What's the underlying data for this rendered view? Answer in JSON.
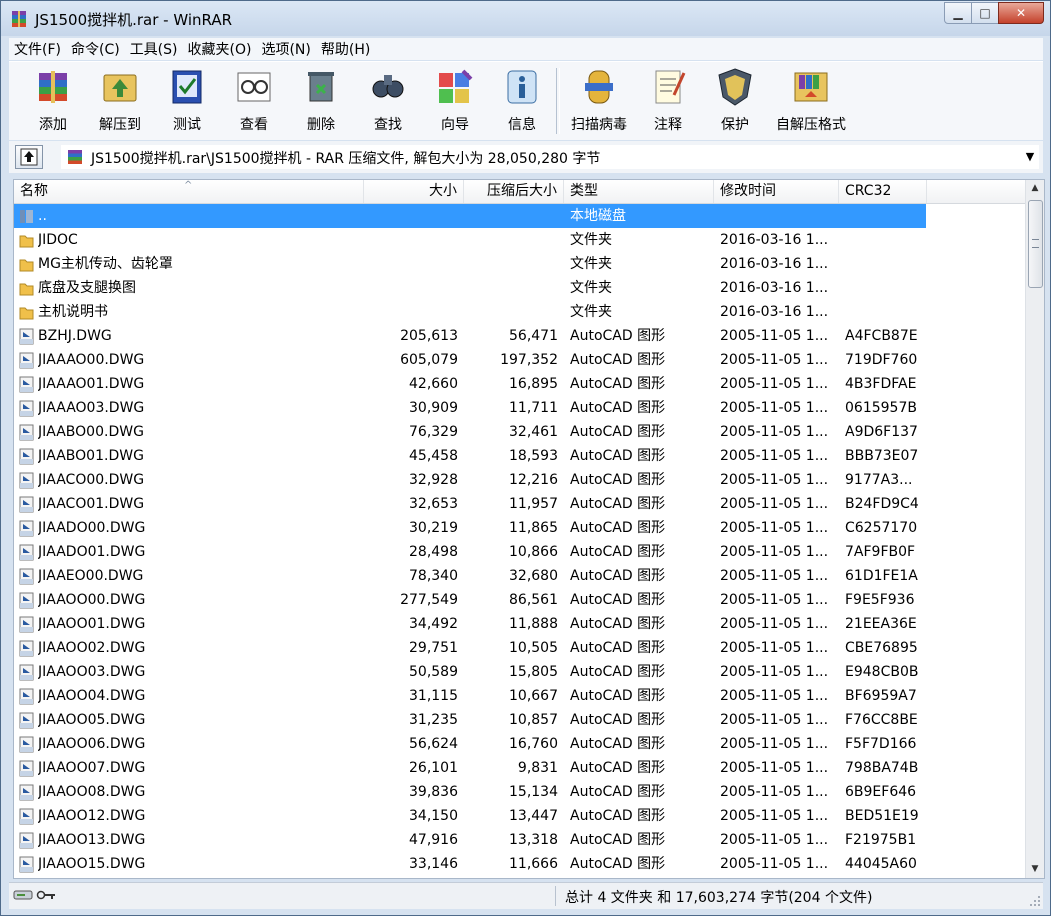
{
  "window": {
    "title": "JS1500搅拌机.rar - WinRAR"
  },
  "menu": [
    {
      "label": "文件(F)",
      "name": "menu-file"
    },
    {
      "label": "命令(C)",
      "name": "menu-commands"
    },
    {
      "label": "工具(S)",
      "name": "menu-tools"
    },
    {
      "label": "收藏夹(O)",
      "name": "menu-favorites"
    },
    {
      "label": "选项(N)",
      "name": "menu-options"
    },
    {
      "label": "帮助(H)",
      "name": "menu-help"
    }
  ],
  "toolbar": [
    {
      "label": "添加",
      "icon": "add-archive-icon"
    },
    {
      "label": "解压到",
      "icon": "extract-to-icon"
    },
    {
      "label": "测试",
      "icon": "test-icon"
    },
    {
      "label": "查看",
      "icon": "view-icon"
    },
    {
      "label": "删除",
      "icon": "delete-icon"
    },
    {
      "label": "查找",
      "icon": "find-icon"
    },
    {
      "label": "向导",
      "icon": "wizard-icon"
    },
    {
      "label": "信息",
      "icon": "info-icon"
    },
    {
      "label": "扫描病毒",
      "icon": "virus-scan-icon"
    },
    {
      "label": "注释",
      "icon": "comment-icon"
    },
    {
      "label": "保护",
      "icon": "protect-icon"
    },
    {
      "label": "自解压格式",
      "icon": "sfx-icon"
    }
  ],
  "address": {
    "path": "JS1500搅拌机.rar\\JS1500搅拌机 - RAR 压缩文件, 解包大小为 28,050,280 字节"
  },
  "columns": {
    "name": "名称",
    "size": "大小",
    "packed": "压缩后大小",
    "type": "类型",
    "modified": "修改时间",
    "crc": "CRC32"
  },
  "files": [
    {
      "icon": "parent-folder-icon",
      "name": "..",
      "size": "",
      "packed": "",
      "type": "本地磁盘",
      "modified": "",
      "crc": "",
      "selected": true
    },
    {
      "icon": "folder-icon",
      "name": "JIDOC",
      "size": "",
      "packed": "",
      "type": "文件夹",
      "modified": "2016-03-16 1...",
      "crc": ""
    },
    {
      "icon": "folder-icon",
      "name": "MG主机传动、齿轮罩",
      "size": "",
      "packed": "",
      "type": "文件夹",
      "modified": "2016-03-16 1...",
      "crc": ""
    },
    {
      "icon": "folder-icon",
      "name": "底盘及支腿换图",
      "size": "",
      "packed": "",
      "type": "文件夹",
      "modified": "2016-03-16 1...",
      "crc": ""
    },
    {
      "icon": "folder-icon",
      "name": "主机说明书",
      "size": "",
      "packed": "",
      "type": "文件夹",
      "modified": "2016-03-16 1...",
      "crc": ""
    },
    {
      "icon": "dwg-file-icon",
      "name": "BZHJ.DWG",
      "size": "205,613",
      "packed": "56,471",
      "type": "AutoCAD 图形",
      "modified": "2005-11-05 1...",
      "crc": "A4FCB87E"
    },
    {
      "icon": "dwg-file-icon",
      "name": "JIAAAO00.DWG",
      "size": "605,079",
      "packed": "197,352",
      "type": "AutoCAD 图形",
      "modified": "2005-11-05 1...",
      "crc": "719DF760"
    },
    {
      "icon": "dwg-file-icon",
      "name": "JIAAAO01.DWG",
      "size": "42,660",
      "packed": "16,895",
      "type": "AutoCAD 图形",
      "modified": "2005-11-05 1...",
      "crc": "4B3FDFAE"
    },
    {
      "icon": "dwg-file-icon",
      "name": "JIAAAO03.DWG",
      "size": "30,909",
      "packed": "11,711",
      "type": "AutoCAD 图形",
      "modified": "2005-11-05 1...",
      "crc": "0615957B"
    },
    {
      "icon": "dwg-file-icon",
      "name": "JIAABO00.DWG",
      "size": "76,329",
      "packed": "32,461",
      "type": "AutoCAD 图形",
      "modified": "2005-11-05 1...",
      "crc": "A9D6F137"
    },
    {
      "icon": "dwg-file-icon",
      "name": "JIAABO01.DWG",
      "size": "45,458",
      "packed": "18,593",
      "type": "AutoCAD 图形",
      "modified": "2005-11-05 1...",
      "crc": "BBB73E07"
    },
    {
      "icon": "dwg-file-icon",
      "name": "JIAACO00.DWG",
      "size": "32,928",
      "packed": "12,216",
      "type": "AutoCAD 图形",
      "modified": "2005-11-05 1...",
      "crc": "9177A3..."
    },
    {
      "icon": "dwg-file-icon",
      "name": "JIAACO01.DWG",
      "size": "32,653",
      "packed": "11,957",
      "type": "AutoCAD 图形",
      "modified": "2005-11-05 1...",
      "crc": "B24FD9C4"
    },
    {
      "icon": "dwg-file-icon",
      "name": "JIAADO00.DWG",
      "size": "30,219",
      "packed": "11,865",
      "type": "AutoCAD 图形",
      "modified": "2005-11-05 1...",
      "crc": "C6257170"
    },
    {
      "icon": "dwg-file-icon",
      "name": "JIAADO01.DWG",
      "size": "28,498",
      "packed": "10,866",
      "type": "AutoCAD 图形",
      "modified": "2005-11-05 1...",
      "crc": "7AF9FB0F"
    },
    {
      "icon": "dwg-file-icon",
      "name": "JIAAEO00.DWG",
      "size": "78,340",
      "packed": "32,680",
      "type": "AutoCAD 图形",
      "modified": "2005-11-05 1...",
      "crc": "61D1FE1A"
    },
    {
      "icon": "dwg-file-icon",
      "name": "JIAAOO00.DWG",
      "size": "277,549",
      "packed": "86,561",
      "type": "AutoCAD 图形",
      "modified": "2005-11-05 1...",
      "crc": "F9E5F936"
    },
    {
      "icon": "dwg-file-icon",
      "name": "JIAAOO01.DWG",
      "size": "34,492",
      "packed": "11,888",
      "type": "AutoCAD 图形",
      "modified": "2005-11-05 1...",
      "crc": "21EEA36E"
    },
    {
      "icon": "dwg-file-icon",
      "name": "JIAAOO02.DWG",
      "size": "29,751",
      "packed": "10,505",
      "type": "AutoCAD 图形",
      "modified": "2005-11-05 1...",
      "crc": "CBE76895"
    },
    {
      "icon": "dwg-file-icon",
      "name": "JIAAOO03.DWG",
      "size": "50,589",
      "packed": "15,805",
      "type": "AutoCAD 图形",
      "modified": "2005-11-05 1...",
      "crc": "E948CB0B"
    },
    {
      "icon": "dwg-file-icon",
      "name": "JIAAOO04.DWG",
      "size": "31,115",
      "packed": "10,667",
      "type": "AutoCAD 图形",
      "modified": "2005-11-05 1...",
      "crc": "BF6959A7"
    },
    {
      "icon": "dwg-file-icon",
      "name": "JIAAOO05.DWG",
      "size": "31,235",
      "packed": "10,857",
      "type": "AutoCAD 图形",
      "modified": "2005-11-05 1...",
      "crc": "F76CC8BE"
    },
    {
      "icon": "dwg-file-icon",
      "name": "JIAAOO06.DWG",
      "size": "56,624",
      "packed": "16,760",
      "type": "AutoCAD 图形",
      "modified": "2005-11-05 1...",
      "crc": "F5F7D166"
    },
    {
      "icon": "dwg-file-icon",
      "name": "JIAAOO07.DWG",
      "size": "26,101",
      "packed": "9,831",
      "type": "AutoCAD 图形",
      "modified": "2005-11-05 1...",
      "crc": "798BA74B"
    },
    {
      "icon": "dwg-file-icon",
      "name": "JIAAOO08.DWG",
      "size": "39,836",
      "packed": "15,134",
      "type": "AutoCAD 图形",
      "modified": "2005-11-05 1...",
      "crc": "6B9EF646"
    },
    {
      "icon": "dwg-file-icon",
      "name": "JIAAOO12.DWG",
      "size": "34,150",
      "packed": "13,447",
      "type": "AutoCAD 图形",
      "modified": "2005-11-05 1...",
      "crc": "BED51E19"
    },
    {
      "icon": "dwg-file-icon",
      "name": "JIAAOO13.DWG",
      "size": "47,916",
      "packed": "13,318",
      "type": "AutoCAD 图形",
      "modified": "2005-11-05 1...",
      "crc": "F21975B1"
    },
    {
      "icon": "dwg-file-icon",
      "name": "JIAAOO15.DWG",
      "size": "33,146",
      "packed": "11,666",
      "type": "AutoCAD 图形",
      "modified": "2005-11-05 1...",
      "crc": "44045A60"
    }
  ],
  "status": {
    "text": "总计 4 文件夹 和 17,603,274 字节(204 个文件)"
  },
  "colors": {
    "selection": "#3399ff",
    "folder": "#f0c04a",
    "close_button": "#c4412b"
  }
}
